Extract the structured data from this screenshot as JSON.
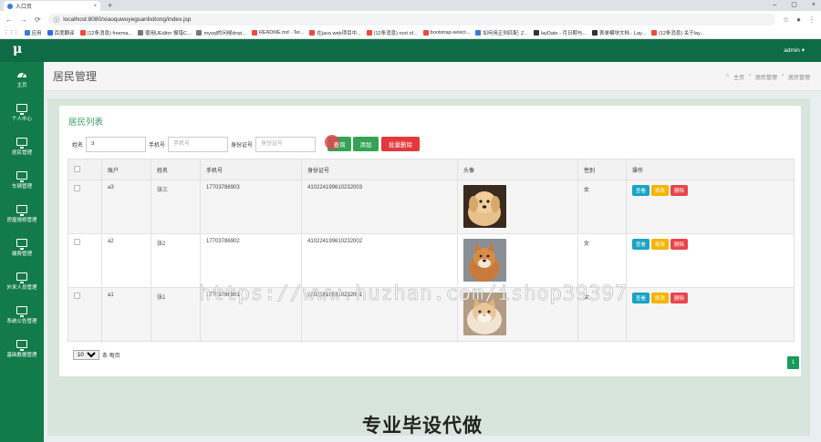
{
  "browser": {
    "tab_title": "入口页",
    "tab_close": "×",
    "new_tab": "+",
    "url": "localhost:8080/xiaoquwuyeguanlixitong/index.jsp",
    "win_min": "–",
    "win_max": "▢",
    "win_close": "×",
    "bookmarks": [
      {
        "label": "应用",
        "color": "#3a7bd5"
      },
      {
        "label": "百度翻译",
        "color": "#2c6fe8"
      },
      {
        "label": "(12条消息) freema...",
        "color": "#e94b3c"
      },
      {
        "label": "使用UEditor 报错C...",
        "color": "#777777"
      },
      {
        "label": "mysql的问候drop...",
        "color": "#777777"
      },
      {
        "label": "README.md · Ter...",
        "color": "#e94b3c"
      },
      {
        "label": "在java web项目中...",
        "color": "#e94b3c"
      },
      {
        "label": "(12条消息) root of...",
        "color": "#e94b3c"
      },
      {
        "label": "bootstrap-select...",
        "color": "#e94b3c"
      },
      {
        "label": "如何用正则匹配: Z...",
        "color": "#3a7bd5"
      },
      {
        "label": "layDate - 月日期与...",
        "color": "#333333"
      },
      {
        "label": "表单模块文档 - Lay...",
        "color": "#333333"
      },
      {
        "label": "(12条消息) 关于lay...",
        "color": "#e94b3c"
      }
    ]
  },
  "app": {
    "logo": "μ",
    "user": "admin ▾",
    "sidebar": [
      {
        "label": "主页",
        "icon": "gauge-icon"
      },
      {
        "label": "个人中心",
        "icon": "monitor-icon"
      },
      {
        "label": "居民管理",
        "icon": "monitor-icon"
      },
      {
        "label": "车辆管理",
        "icon": "monitor-icon"
      },
      {
        "label": "房屋报修管理",
        "icon": "monitor-icon"
      },
      {
        "label": "缴费管理",
        "icon": "monitor-icon"
      },
      {
        "label": "外来人员管理",
        "icon": "monitor-icon"
      },
      {
        "label": "系统公告管理",
        "icon": "monitor-icon"
      },
      {
        "label": "基础数据管理",
        "icon": "monitor-icon"
      }
    ],
    "page_title": "居民管理",
    "breadcrumb": {
      "home": "主页",
      "sep": "›",
      "level1": "居民管理",
      "level2": "居民管理"
    },
    "card_title": "居民列表",
    "search": {
      "name_label": "姓名",
      "name_value": "3",
      "phone_label": "手机号",
      "phone_placeholder": "手机号",
      "id_label": "身份证号",
      "id_placeholder": "身份证号",
      "search_btn": "查询",
      "add_btn": "添加",
      "batch_delete_btn": "批量删除"
    },
    "table": {
      "columns": [
        "账户",
        "姓名",
        "手机号",
        "身份证号",
        "头像",
        "性别",
        "操作"
      ],
      "rows": [
        {
          "account": "a3",
          "name": "张三",
          "phone": "17703786903",
          "id_no": "410224199610232003",
          "gender": "女"
        },
        {
          "account": "a2",
          "name": "张2",
          "phone": "17703786902",
          "id_no": "410224199610232002",
          "gender": "女"
        },
        {
          "account": "a1",
          "name": "张1",
          "phone": "17703786901",
          "id_no": "410224199610232001",
          "gender": "女"
        }
      ],
      "actions": {
        "view": "查看",
        "edit": "修改",
        "delete": "删除"
      }
    },
    "pager": {
      "page_size": "10",
      "per_page_label": "条 每页",
      "current_page": "1"
    }
  },
  "overlays": {
    "watermark": "https://www.huzhan.com/ishop39397",
    "banner": "专业毕设代做"
  },
  "colors": {
    "topbar": "#0e6b45",
    "sidebar": "#137b4a",
    "accent_green": "#35a355",
    "danger": "#e4393c",
    "info": "#1aa3c4",
    "warning": "#f5b400"
  }
}
